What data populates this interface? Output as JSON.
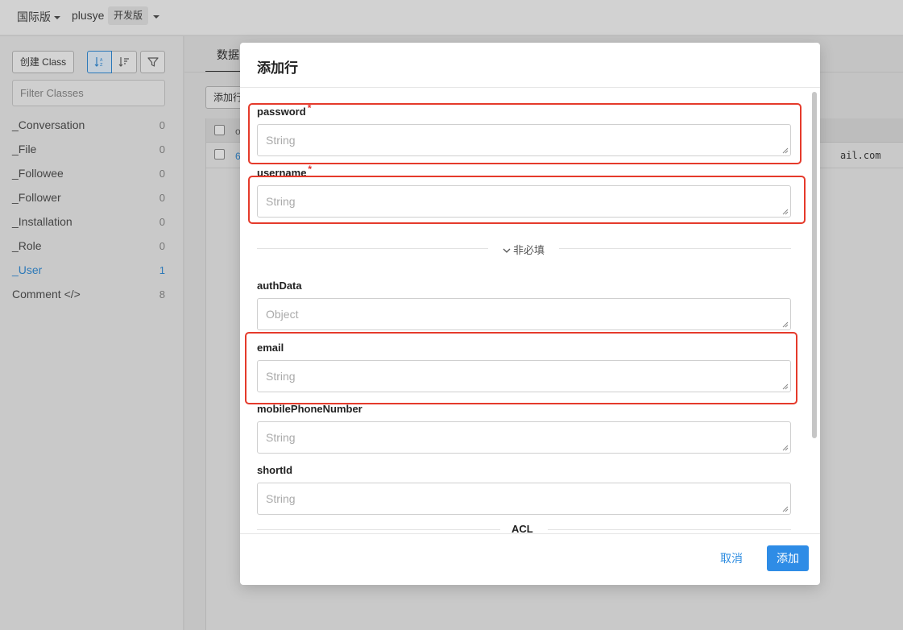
{
  "topbar": {
    "region_label": "国际版",
    "app_name": "plusye",
    "env_badge": "开发版"
  },
  "sidebar": {
    "create_class_label": "创建 Class",
    "filter_placeholder": "Filter Classes",
    "classes": [
      {
        "name": "_Conversation",
        "count": "0"
      },
      {
        "name": "_File",
        "count": "0"
      },
      {
        "name": "_Followee",
        "count": "0"
      },
      {
        "name": "_Follower",
        "count": "0"
      },
      {
        "name": "_Installation",
        "count": "0"
      },
      {
        "name": "_Role",
        "count": "0"
      },
      {
        "name": "_User",
        "count": "1"
      },
      {
        "name": "Comment </>",
        "count": "8"
      }
    ],
    "active_class": "_User"
  },
  "content": {
    "tab_label": "数据",
    "add_row_label": "添加行",
    "header_peek": "o",
    "row_id_peek": "6",
    "row_email_peek": "ail.com"
  },
  "modal": {
    "title": "添加行",
    "required_mark": "*",
    "fields": {
      "password": {
        "label": "password",
        "placeholder": "String",
        "required": true
      },
      "username": {
        "label": "username",
        "placeholder": "String",
        "required": true
      },
      "authData": {
        "label": "authData",
        "placeholder": "Object"
      },
      "email": {
        "label": "email",
        "placeholder": "String"
      },
      "mobilePhoneNumber": {
        "label": "mobilePhoneNumber",
        "placeholder": "String"
      },
      "shortId": {
        "label": "shortId",
        "placeholder": "String"
      }
    },
    "optional_divider": "非必填",
    "acl_divider": "ACL",
    "cancel_label": "取消",
    "add_label": "添加"
  },
  "colors": {
    "accent": "#2e8ce6",
    "highlight": "#e53a2b",
    "required": "#e0302b"
  }
}
